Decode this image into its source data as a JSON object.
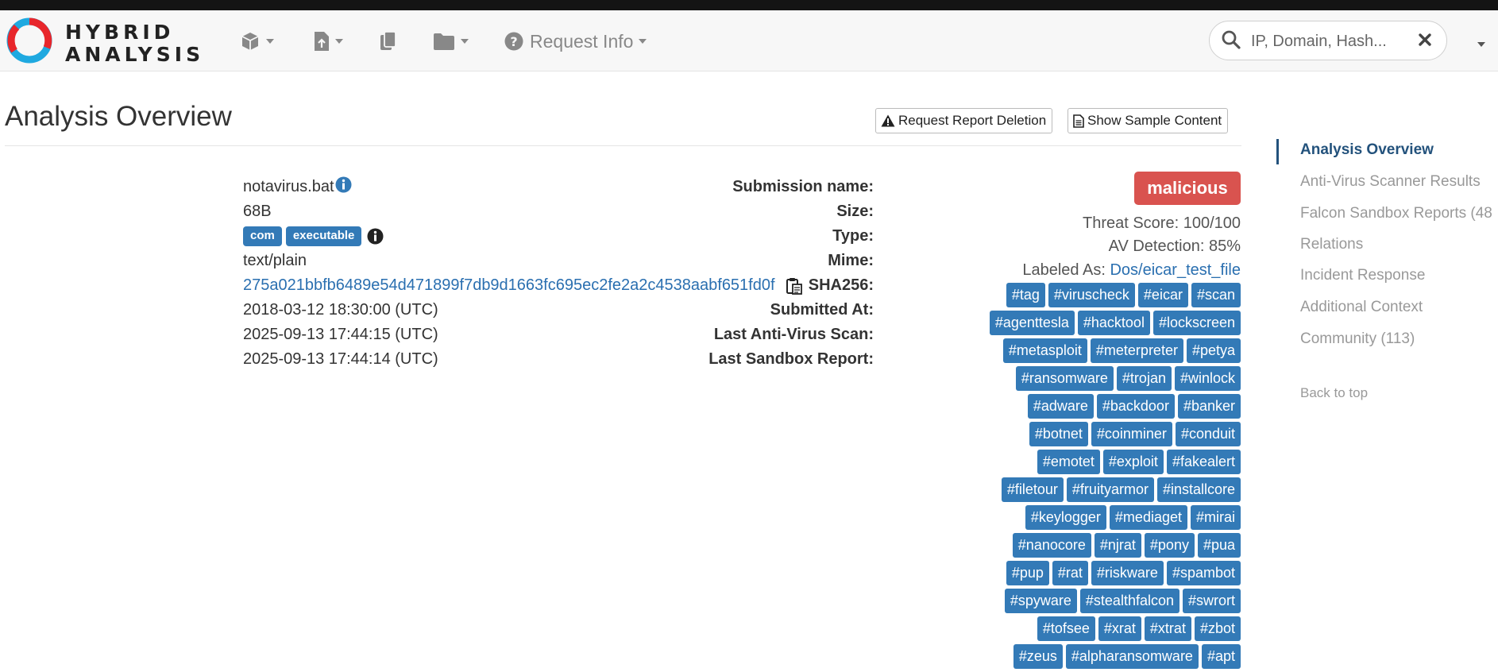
{
  "brand": {
    "line1": "HYBRID",
    "line2": "ANALYSIS",
    "accent_red": "#e8262b",
    "accent_blue": "#1fa9e0"
  },
  "navbar": {
    "items": [
      {
        "icon": "cube-icon",
        "has_dropdown": true
      },
      {
        "icon": "file-upload-icon",
        "has_dropdown": true
      },
      {
        "icon": "copy-icon",
        "has_dropdown": false
      },
      {
        "icon": "folder-icon",
        "has_dropdown": true
      }
    ],
    "request_info_label": "Request Info",
    "search_placeholder": "IP, Domain, Hash..."
  },
  "page": {
    "title": "Analysis Overview",
    "buttons": {
      "request_deletion": "Request Report Deletion",
      "show_sample": "Show Sample Content"
    }
  },
  "details": {
    "submission_name": {
      "label": "Submission name:",
      "value": "notavirus.bat"
    },
    "size": {
      "label": "Size:",
      "value": "68B"
    },
    "type": {
      "label": "Type:",
      "badges": [
        "com",
        "executable"
      ]
    },
    "mime": {
      "label": "Mime:",
      "value": "text/plain"
    },
    "sha256": {
      "label": "SHA256:",
      "value": "275a021bbfb6489e54d471899f7db9d1663fc695ec2fe2a2c4538aabf651fd0f"
    },
    "submitted_at": {
      "label": "Submitted At:",
      "value": "2018-03-12 18:30:00 (UTC)"
    },
    "last_av_scan": {
      "label": "Last Anti-Virus Scan:",
      "value": "2025-09-13 17:44:15 (UTC)"
    },
    "last_sandbox": {
      "label": "Last Sandbox Report:",
      "value": "2025-09-13 17:44:14 (UTC)"
    }
  },
  "verdict": {
    "label": "malicious",
    "color": "#d9534f",
    "threat_score": "Threat Score: 100/100",
    "av_detection": "AV Detection: 85%",
    "labeled_as_prefix": "Labeled As:",
    "labeled_as_value": "Dos/eicar_test_file"
  },
  "tags": [
    [
      "#tag",
      "#viruscheck",
      "#eicar",
      "#scan"
    ],
    [
      "#agenttesla",
      "#hacktool",
      "#lockscreen"
    ],
    [
      "#metasploit",
      "#meterpreter",
      "#petya"
    ],
    [
      "#ransomware",
      "#trojan",
      "#winlock"
    ],
    [
      "#adware",
      "#backdoor",
      "#banker"
    ],
    [
      "#botnet",
      "#coinminer",
      "#conduit"
    ],
    [
      "#emotet",
      "#exploit",
      "#fakealert"
    ],
    [
      "#filetour",
      "#fruityarmor",
      "#installcore"
    ],
    [
      "#keylogger",
      "#mediaget",
      "#mirai"
    ],
    [
      "#nanocore",
      "#njrat",
      "#pony",
      "#pua"
    ],
    [
      "#pup",
      "#rat",
      "#riskware",
      "#spambot"
    ],
    [
      "#spyware",
      "#stealthfalcon",
      "#swrort"
    ],
    [
      "#tofsee",
      "#xrat",
      "#xtrat",
      "#zbot"
    ],
    [
      "#zeus",
      "#alpharansomware",
      "#apt"
    ]
  ],
  "sidenav": {
    "items": [
      "Analysis Overview",
      "Anti-Virus Scanner Results",
      "Falcon Sandbox Reports (48",
      "Relations",
      "Incident Response",
      "Additional Context",
      "Community (113)"
    ],
    "active": "Analysis Overview",
    "back_to_top": "Back to top"
  }
}
